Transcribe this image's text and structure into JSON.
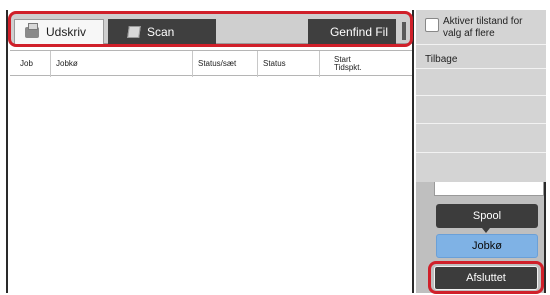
{
  "tabs": {
    "print_label": "Udskriv",
    "scan_label": "Scan",
    "find_file_label": "Genfind Fil",
    "print_icon": "printer-icon",
    "scan_icon": "scanner-icon"
  },
  "table": {
    "columns": {
      "job": "Job",
      "queue": "Jobkø",
      "status_set": "Status/sæt",
      "status": "Status",
      "start_line1": "Start",
      "start_line2": "Tidspkt."
    },
    "rows": []
  },
  "side_panel": {
    "multi_select_label": "Aktiver tilstand for valg af flere",
    "multi_select_checked": false,
    "back_label": "Tilbage"
  },
  "buttons": {
    "spool_label": "Spool",
    "job_queue_label": "Jobkø",
    "completed_label": "Afsluttet"
  },
  "colors": {
    "highlight": "#d0202a",
    "selected_button": "#7fb2e5",
    "dark_button": "#3c3c3c"
  }
}
